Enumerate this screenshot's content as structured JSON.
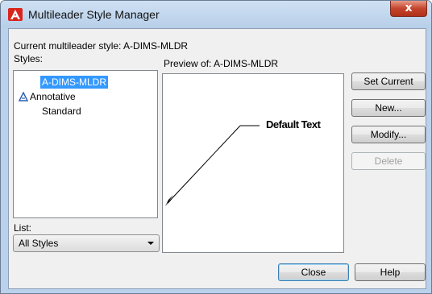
{
  "window": {
    "title": "Multileader Style Manager",
    "close_glyph": "x"
  },
  "current_style": {
    "label": "Current multileader style: A-DIMS-MLDR"
  },
  "styles": {
    "label": "Styles:",
    "items": [
      {
        "label": "A-DIMS-MLDR",
        "selected": true,
        "icon": ""
      },
      {
        "label": "Annotative",
        "selected": false,
        "icon": "annotative-icon"
      },
      {
        "label": "Standard",
        "selected": false,
        "icon": ""
      }
    ]
  },
  "list_filter": {
    "label": "List:",
    "value": "All Styles"
  },
  "preview": {
    "label": "Preview of: A-DIMS-MLDR",
    "sample_text": "Default Text"
  },
  "buttons": {
    "set_current": "Set Current",
    "new": "New...",
    "modify": "Modify...",
    "delete": "Delete",
    "close": "Close",
    "help": "Help"
  },
  "colors": {
    "title_bar": "#b9d1ea",
    "selection": "#3399ff",
    "app_icon": "#d9261c",
    "close_button": "#c4452d"
  }
}
